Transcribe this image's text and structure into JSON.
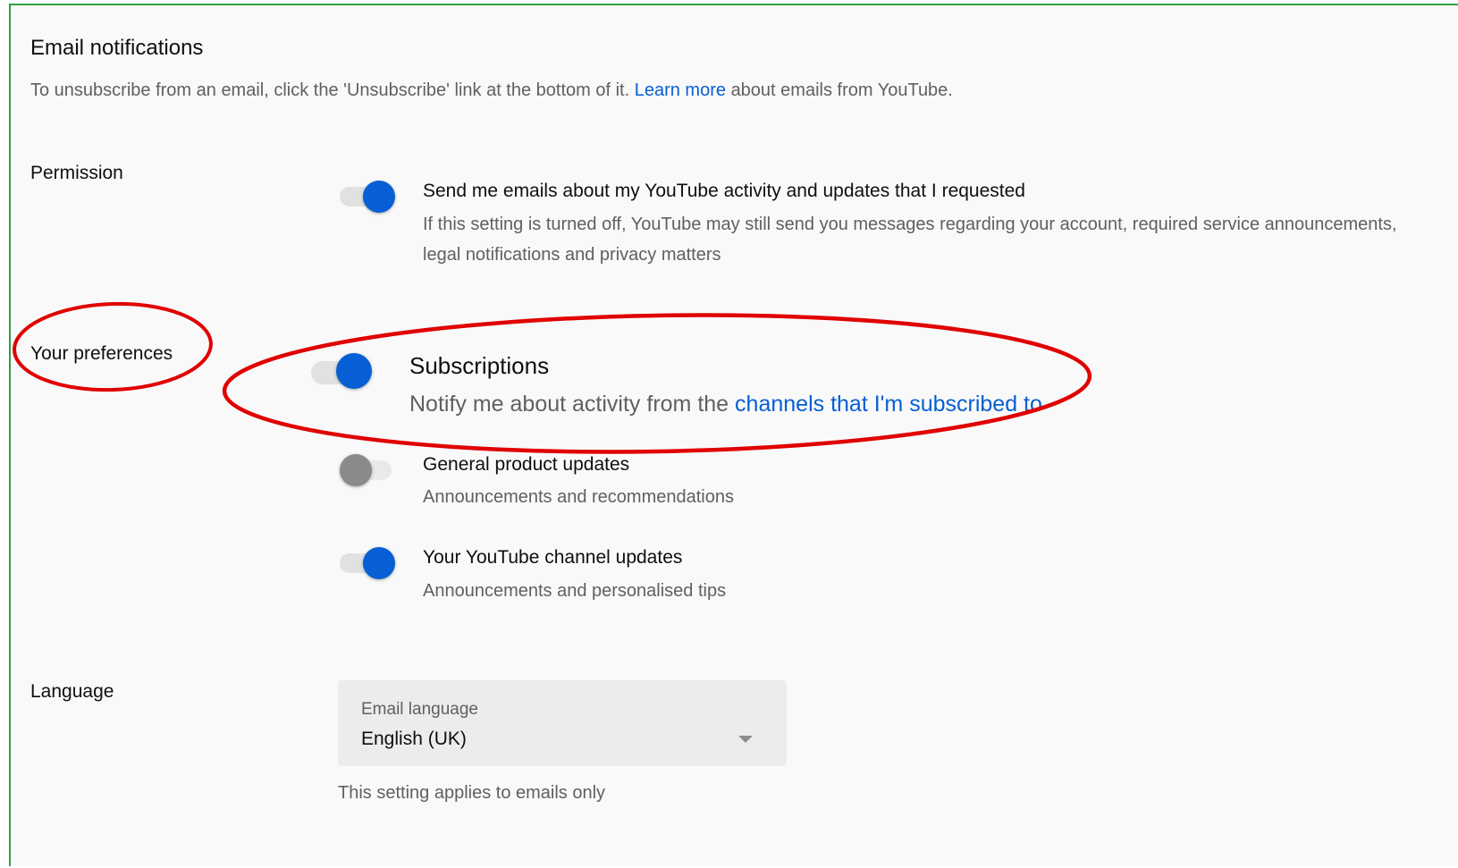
{
  "section": {
    "title": "Email notifications",
    "intro_before": "To unsubscribe from an email, click the 'Unsubscribe' link at the bottom of it.",
    "intro_link": "Learn more",
    "intro_after": "about emails from YouTube."
  },
  "permission": {
    "label": "Permission",
    "item": {
      "title": "Send me emails about my YouTube activity and updates that I requested",
      "description": "If this setting is turned off, YouTube may still send you messages regarding your account, required service announcements, legal notifications and privacy matters",
      "enabled": true
    }
  },
  "preferences": {
    "label": "Your preferences",
    "items": [
      {
        "title": "Subscriptions",
        "description_before": "Notify me about activity from the",
        "description_link": "channels that I'm subscribed to",
        "enabled": true
      },
      {
        "title": "General product updates",
        "description": "Announcements and recommendations",
        "enabled": false
      },
      {
        "title": "Your YouTube channel updates",
        "description": "Announcements and personalised tips",
        "enabled": true
      }
    ]
  },
  "language": {
    "label": "Language",
    "select_label": "Email language",
    "select_value": "English (UK)",
    "helper": "This setting applies to emails only"
  },
  "colors": {
    "accent": "#065fd4",
    "annotation": "#e00000",
    "frame_border": "#2ea043",
    "toggle_off": "#8a8a8a"
  }
}
